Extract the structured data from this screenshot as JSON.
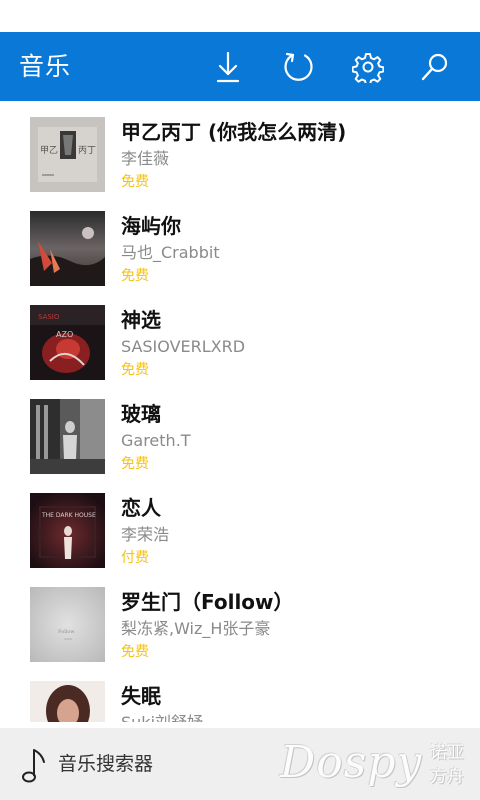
{
  "header": {
    "title": "音乐",
    "background_color": "#0a78d7",
    "actions": [
      {
        "name": "download-icon"
      },
      {
        "name": "refresh-icon"
      },
      {
        "name": "settings-icon"
      },
      {
        "name": "search-icon"
      }
    ]
  },
  "songs": [
    {
      "title": "甲乙丙丁 (你我怎么两清)",
      "artist": "李佳薇",
      "price": "免费",
      "cover": "cover-1"
    },
    {
      "title": "海屿你",
      "artist": "马也_Crabbit",
      "price": "免费",
      "cover": "cover-2"
    },
    {
      "title": "神选",
      "artist": "SASIOVERLXRD",
      "price": "免费",
      "cover": "cover-3"
    },
    {
      "title": "玻璃",
      "artist": "Gareth.T",
      "price": "免费",
      "cover": "cover-4"
    },
    {
      "title": "恋人",
      "artist": "李荣浩",
      "price": "付费",
      "cover": "cover-5"
    },
    {
      "title": "罗生门（Follow）",
      "artist": "梨冻紧,Wiz_H张子豪",
      "price": "免费",
      "cover": "cover-6"
    },
    {
      "title": "失眠",
      "artist": "Suki刘舒妤",
      "price": "",
      "cover": "cover-7"
    }
  ],
  "colors": {
    "price": "#f3c317",
    "artist": "#8a8a8a",
    "bottom_bar": "#efefef"
  },
  "bottom_bar": {
    "icon": "music-note-icon",
    "label": "音乐搜索器"
  },
  "watermark": {
    "text": "Dospy",
    "side_text_1": "诺亚",
    "side_text_2": "方舟"
  }
}
